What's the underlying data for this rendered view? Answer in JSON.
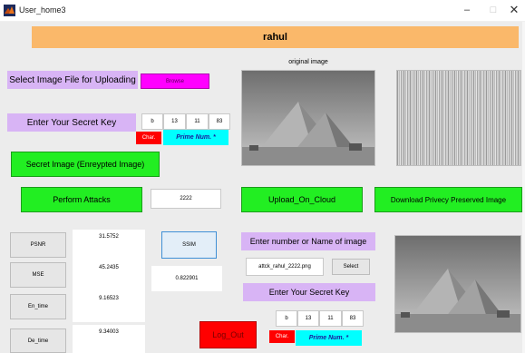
{
  "window": {
    "title": "User_home3",
    "minimize": "–",
    "maximize": "□",
    "close": "✕"
  },
  "header": {
    "username": "rahul"
  },
  "upload": {
    "select_label": "Select Image File for Uploading",
    "browse_button": "Browse"
  },
  "original_image": {
    "caption": "original image"
  },
  "secret_key_top": {
    "label": "Enter Your Secret Key",
    "char_value": "b",
    "prime1": "13",
    "prime2": "11",
    "prime3": "83",
    "char_tag": "Char.",
    "prime_tag": "Prime Num. *"
  },
  "secret_image_button": "Secret Image (Enreypted Image)",
  "perform_attacks_button": "Perform Attacks",
  "attack_value": "2222",
  "upload_cloud_button": "Upload_On_Cloud",
  "download_button": "Download Privecy Preserved Image",
  "metrics": {
    "psnr_label": "PSNR",
    "psnr_value": "31.5752",
    "mse_label": "MSE",
    "mse_value": "45.2435",
    "en_time_label": "En_time",
    "en_time_value": "9.16523",
    "de_time_label": "De_time",
    "de_time_value": "9.34003",
    "ssim_label": "SSIM",
    "ssim_value": "0.822901"
  },
  "logout_button": "Log_Out",
  "image_lookup": {
    "label": "Enter number or Name of image",
    "filename": "attck_rahul_2222.png",
    "select_button": "Select"
  },
  "secret_key_bottom": {
    "label": "Enter Your Secret Key",
    "char_value": "b",
    "prime1": "13",
    "prime2": "11",
    "prime3": "83",
    "char_tag": "Char.",
    "prime_tag": "Prime Num. *"
  },
  "colors": {
    "banner": "#fab86a",
    "lavender": "#d8b4f5",
    "green": "#22ee22",
    "magenta": "#ff00ff",
    "red": "#ff0000",
    "cyan": "#00ffff"
  },
  "icons": [
    "matlab-app-icon",
    "pyramid-photo",
    "noise-photo"
  ]
}
